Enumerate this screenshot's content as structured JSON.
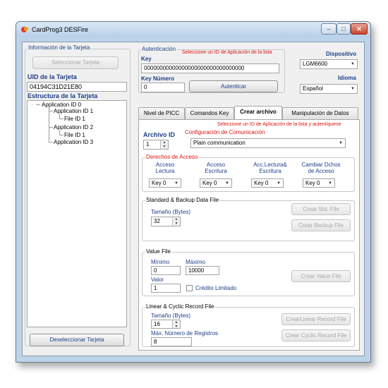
{
  "window": {
    "title": "CardProg3 DESFire",
    "minimize": "–",
    "maximize": "□",
    "close": "✕"
  },
  "left": {
    "info_label": "Información de la Tarjeta",
    "select_card": "Seleccionar Tarjeta",
    "uid_label": "UID de la Tarjeta",
    "uid_value": "04194C31D21E80",
    "structure_label": "Estructura de la Tarjeta",
    "tree": [
      "Application ID 0",
      "Application ID 1",
      "File ID 1",
      "Application ID 2",
      "File ID 1",
      "Application ID 3"
    ],
    "deselect_card": "Deseleccionar Tarjeta"
  },
  "auth": {
    "group_label": "Autenticación",
    "key_label": "Key",
    "warning": "Seleccione un ID de Aplicación de la lista",
    "key_value": "00000000000000000000000000000000",
    "key_number_label": "Key Número",
    "key_number_value": "0",
    "authenticate": "Autenticar"
  },
  "device": {
    "label": "Dispositivo",
    "value": "LGM6600"
  },
  "language": {
    "label": "Idioma",
    "value": "Español"
  },
  "tabs": [
    "Nivel de PICC",
    "Comandos Key",
    "Crear archivo",
    "Manipulación de Datos"
  ],
  "create": {
    "warning": "Seleccione un ID de Aplicación de la lista y autentíquese",
    "file_id_label": "Archivo ID",
    "file_id_value": "1",
    "comm_label": "Configuración de Comunicación",
    "comm_value": "Plain communication",
    "access_label": "Derechos de Acceso",
    "access_cols": [
      {
        "label1": "Acceso",
        "label2": "Lectura",
        "value": "Key 0"
      },
      {
        "label1": "Acceso",
        "label2": "Escritura",
        "value": "Key 0"
      },
      {
        "label1": "Acc.Lectura&",
        "label2": "Escritura",
        "value": "Key 0"
      },
      {
        "label1": "Cambiar Dchos",
        "label2": "de Acceso",
        "value": "Key 0"
      }
    ],
    "std_label": "Standard & Backup Data File",
    "size_label": "Tamaño (Bytes)",
    "size_value": "32",
    "create_std": "Crear Std. File",
    "create_backup": "Crear Backup File",
    "value_label": "Value File",
    "min_label": "Mínimo",
    "min_value": "0",
    "max_label": "Máximo",
    "max_value": "10000",
    "val_label": "Valor",
    "val_value": "1",
    "limited_credit": "Crédito Limitado",
    "create_value": "Crear Value File",
    "record_label": "Linear & Cyclic Record File",
    "rec_size_label": "Tamaño (Bytes)",
    "rec_size_value": "16",
    "rec_max_label": "Máx. Número de Registros",
    "rec_max_value": "8",
    "create_linear": "CrearLinear Record File",
    "create_cyclic": "Crear Cyclic Record File"
  }
}
